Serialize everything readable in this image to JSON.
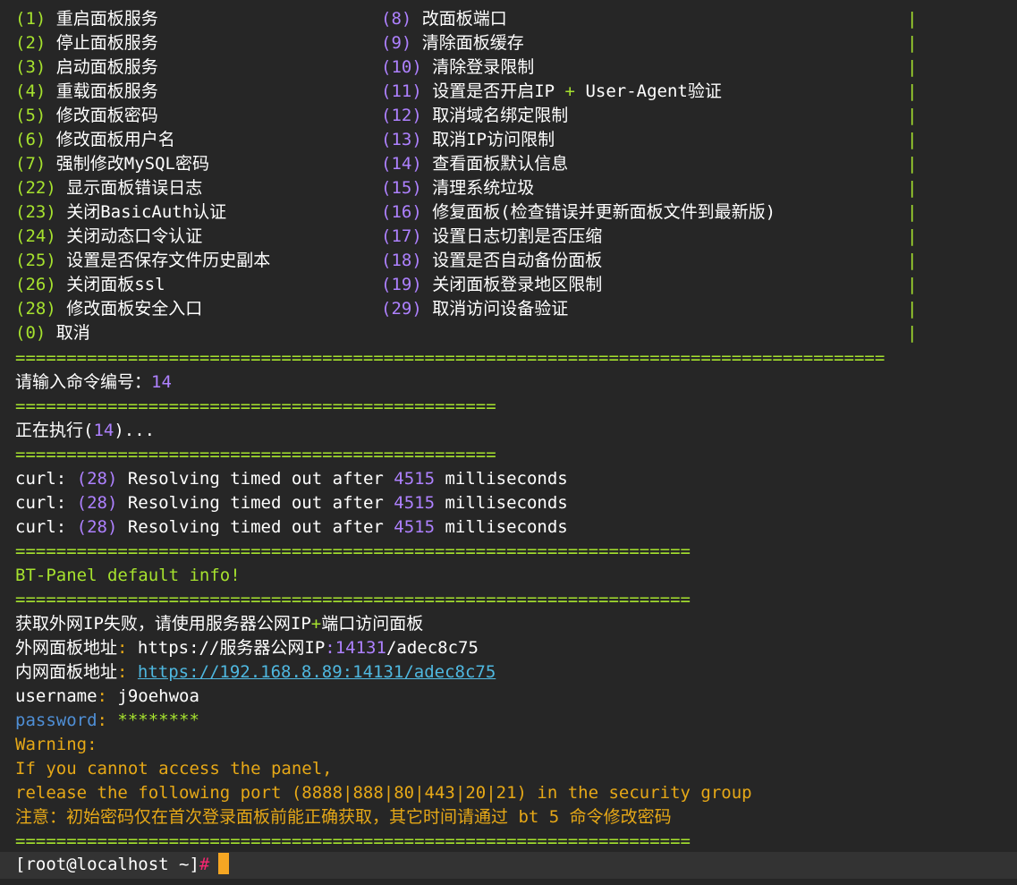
{
  "menu": {
    "left": [
      {
        "num": "(1)",
        "label": "重启面板服务"
      },
      {
        "num": "(2)",
        "label": "停止面板服务"
      },
      {
        "num": "(3)",
        "label": "启动面板服务"
      },
      {
        "num": "(4)",
        "label": "重载面板服务"
      },
      {
        "num": "(5)",
        "label": "修改面板密码"
      },
      {
        "num": "(6)",
        "label": "修改面板用户名"
      },
      {
        "num": "(7)",
        "label": "强制修改MySQL密码"
      },
      {
        "num": "(22)",
        "label": "显示面板错误日志"
      },
      {
        "num": "(23)",
        "label": "关闭BasicAuth认证"
      },
      {
        "num": "(24)",
        "label": "关闭动态口令认证"
      },
      {
        "num": "(25)",
        "label": "设置是否保存文件历史副本"
      },
      {
        "num": "(26)",
        "label": "关闭面板ssl"
      },
      {
        "num": "(28)",
        "label": "修改面板安全入口"
      },
      {
        "num": "(0)",
        "label": "取消"
      }
    ],
    "right": [
      {
        "num": "(8)",
        "label": "改面板端口"
      },
      {
        "num": "(9)",
        "label": "清除面板缓存"
      },
      {
        "num": "(10)",
        "label": "清除登录限制"
      },
      {
        "num": "(11)",
        "label_a": "设置是否开启IP ",
        "plus": "+",
        "label_b": " User-Agent验证"
      },
      {
        "num": "(12)",
        "label": "取消域名绑定限制"
      },
      {
        "num": "(13)",
        "label": "取消IP访问限制"
      },
      {
        "num": "(14)",
        "label": "查看面板默认信息"
      },
      {
        "num": "(15)",
        "label": "清理系统垃圾"
      },
      {
        "num": "(16)",
        "label": "修复面板(检查错误并更新面板文件到最新版)"
      },
      {
        "num": "(17)",
        "label": "设置日志切割是否压缩"
      },
      {
        "num": "(18)",
        "label": "设置是否自动备份面板"
      },
      {
        "num": "(19)",
        "label": "关闭面板登录地区限制"
      },
      {
        "num": "(29)",
        "label": "取消访问设备验证"
      }
    ],
    "bar_char": "|"
  },
  "separators": {
    "long": "=====================================================================================",
    "short": "===============================================",
    "medium": "=================================================================="
  },
  "input_prompt": {
    "label": "请输入命令编号：",
    "value": "14"
  },
  "executing": {
    "prefix": "正在执行(",
    "num": "14",
    "suffix": ")..."
  },
  "curl_lines": [
    {
      "a": "curl: ",
      "code": "(28)",
      "b": " Resolving timed out after ",
      "ms": "4515",
      "c": " milliseconds"
    },
    {
      "a": "curl: ",
      "code": "(28)",
      "b": " Resolving timed out after ",
      "ms": "4515",
      "c": " milliseconds"
    },
    {
      "a": "curl: ",
      "code": "(28)",
      "b": " Resolving timed out after ",
      "ms": "4515",
      "c": " milliseconds"
    }
  ],
  "panel_info": {
    "title": "BT-Panel default info!",
    "ip_fail_a": "获取外网IP失败，请使用服务器公网IP",
    "ip_fail_plus": "+",
    "ip_fail_b": "端口访问面板",
    "external_label": "外网面板地址",
    "colon": ": ",
    "external_url_a": "https://服务器公网IP",
    "external_url_port": ":14131",
    "external_url_b": "/adec8c75",
    "internal_label": "内网面板地址",
    "internal_url": "https://192.168.8.89:14131/adec8c75",
    "username_label": "username",
    "username_value": "j9oehwoa",
    "password_label": "password",
    "password_value": "********",
    "warning": "Warning:",
    "warn_line1": "If you cannot access the panel,",
    "warn_line2": "release the following port (8888|888|80|443|20|21) in the security group",
    "notice": "注意：初始密码仅在首次登录面板前能正确获取，其它时间请通过 bt 5 命令修改密码"
  },
  "shell_prompt": {
    "text": "[root@localhost ~]",
    "hash": "#"
  }
}
